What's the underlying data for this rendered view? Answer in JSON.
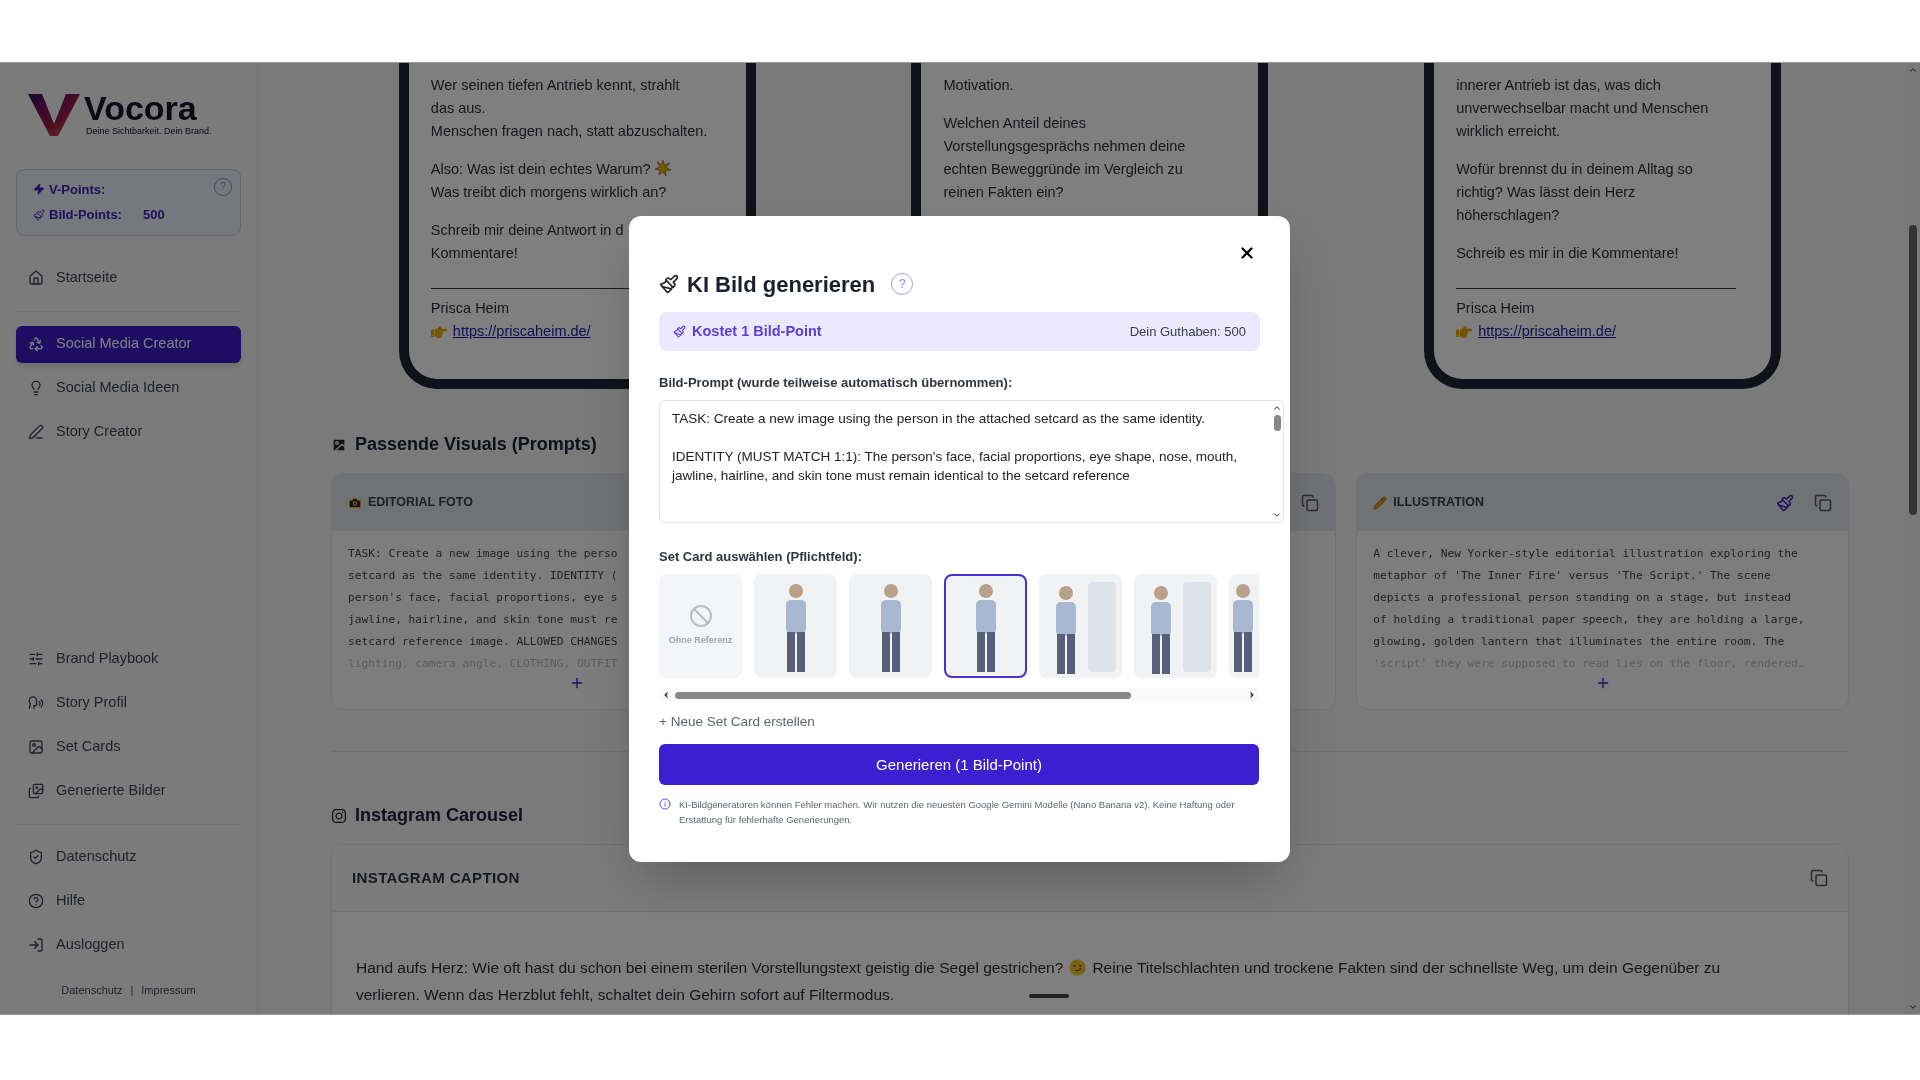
{
  "sidebar": {
    "brand": "Vocora",
    "tagline": "Deine Sichtbarkeit. Dein Brand.",
    "help": "?",
    "points": [
      {
        "label": "V-Points:"
      },
      {
        "label": "Bild-Points:",
        "value": "500"
      }
    ],
    "nav": [
      {
        "items": [
          {
            "label": "Startseite",
            "selected": false
          }
        ]
      },
      {
        "items": [
          {
            "label": "Social Media Creator",
            "selected": true
          },
          {
            "label": "Social Media Ideen",
            "selected": false
          },
          {
            "label": "Story Creator",
            "selected": false
          }
        ]
      },
      {
        "items": [
          {
            "label": "Brand Playbook",
            "selected": false
          },
          {
            "label": "Story Profil",
            "selected": false
          },
          {
            "label": "Set Cards",
            "selected": false
          },
          {
            "label": "Generierte Bilder",
            "selected": false
          }
        ]
      },
      {
        "items": [
          {
            "label": "Datenschutz",
            "selected": false
          },
          {
            "label": "Hilfe",
            "selected": false
          },
          {
            "label": "Ausloggen",
            "selected": false
          }
        ]
      }
    ],
    "footer_links": [
      "Datenschutz",
      "Impressum"
    ],
    "footer_separator": "|"
  },
  "phones": [
    {
      "paragraphs": [
        [
          {
            "text": "Wer seinen tiefen Antrieb kennt, strahlt"
          },
          {
            "text": "das aus."
          },
          {
            "text": "Menschen fragen nach, statt abzuschalten."
          }
        ],
        [
          {
            "text": "Also: Was ist dein echtes Warum?",
            "kind": "burst"
          },
          {
            "text": "Was treibt dich morgens wirklich an?"
          }
        ],
        [
          {
            "text": "Schreib mir deine Antwort in d"
          },
          {
            "text": "Kommentare!"
          }
        ]
      ],
      "signature": "Prisca Heim",
      "link": "https://priscaheim.de/"
    },
    {
      "paragraphs": [
        [
          {
            "text": "Motivation."
          }
        ],
        [
          {
            "text": "Welchen Anteil deines"
          },
          {
            "text": "Vorstellungsgesprächs nehmen deine"
          },
          {
            "text": "echten Beweggründe im Vergleich zu"
          },
          {
            "text": "reinen Fakten ein?"
          }
        ]
      ]
    },
    {
      "paragraphs": [
        [
          {
            "text": "innerer Antrieb ist das, was dich"
          },
          {
            "text": "unverwechselbar macht und Menschen"
          },
          {
            "text": "wirklich erreicht."
          }
        ],
        [
          {
            "text": "Wofür brennst du in deinem Alltag so"
          },
          {
            "text": "richtig? Was lässt dein Herz"
          },
          {
            "text": "höherschlagen?"
          }
        ],
        [
          {
            "text": "Schreib es mir in die Kommentare!"
          }
        ]
      ],
      "signature": "Prisca Heim",
      "link": "https://priscaheim.de/"
    }
  ],
  "visuals": {
    "heading": "Passende Visuals (Prompts)",
    "cards": [
      {
        "kind": "photo",
        "title": "EDITORIAL FOTO",
        "lines": [
          "TASK: Create a new image using the perso",
          "setcard as the same identity. IDENTITY (",
          "person's face, facial proportions, eye s",
          "jawline, hairline, and skin tone must re",
          "setcard reference image. ALLOWED CHANGES",
          "lighting, camera angle, CLOTHING, OUTFIT"
        ]
      },
      {
        "kind": "hidden"
      },
      {
        "kind": "illustration",
        "title": "ILLUSTRATION",
        "lines": [
          "A clever, New Yorker-style editorial illustration exploring the",
          "metaphor of 'The Inner Fire' versus 'The Script.' The scene",
          "depicts a professional person standing on a stage, but instead",
          "of holding a traditional paper speech, they are holding a large,",
          "glowing, golden lantern that illuminates the entire room. The",
          "'script' they were supposed to read lies on the floor, rendered…"
        ]
      }
    ]
  },
  "instagram": {
    "heading": "Instagram Carousel",
    "caption_title": "INSTAGRAM CAPTION",
    "caption_parts": [
      "Hand aufs Herz: Wie oft hast du schon bei einem sterilen Vorstellungstext geistig die Segel gestrichen?",
      "Reine Titelschlachten und trockene Fakten sind der schnellste Weg, um dein Gegenüber zu",
      "verlieren. Wenn das Herzblut fehlt, schaltet dein Gehirn sofort auf Filtermodus."
    ]
  },
  "modal": {
    "title": "KI Bild generieren",
    "help": "?",
    "cost": "Kostet 1 Bild-Point",
    "balance": "Dein Guthaben: 500",
    "prompt_label": "Bild-Prompt (wurde teilweise automatisch übernommen):",
    "prompt": "TASK: Create a new image using the person in the attached setcard as the same identity.\n\nIDENTITY (MUST MATCH 1:1): The person's face, facial proportions, eye shape, nose, mouth, jawline, hairline, and skin tone must remain identical to the setcard reference",
    "setcard_label": "Set Card auswählen (Pflichtfeld):",
    "setcards": [
      {
        "kind": "none",
        "label": "Ohne Referenz",
        "selected": false
      },
      {
        "kind": "photo",
        "selected": false
      },
      {
        "kind": "photo",
        "selected": false
      },
      {
        "kind": "photo",
        "selected": true
      },
      {
        "kind": "collage",
        "selected": false
      },
      {
        "kind": "collage",
        "selected": false
      },
      {
        "kind": "partial",
        "selected": false
      }
    ],
    "new_setcard": "+ Neue Set Card erstellen",
    "generate": "Generieren (1 Bild-Point)",
    "note": "KI-Bildgeneratoren können Fehler machen. Wir nutzen die neuesten Google Gemini Modelle (Nano Banana v2). Keine Haftung oder Erstattung für fehlerhafte Generierungen."
  }
}
